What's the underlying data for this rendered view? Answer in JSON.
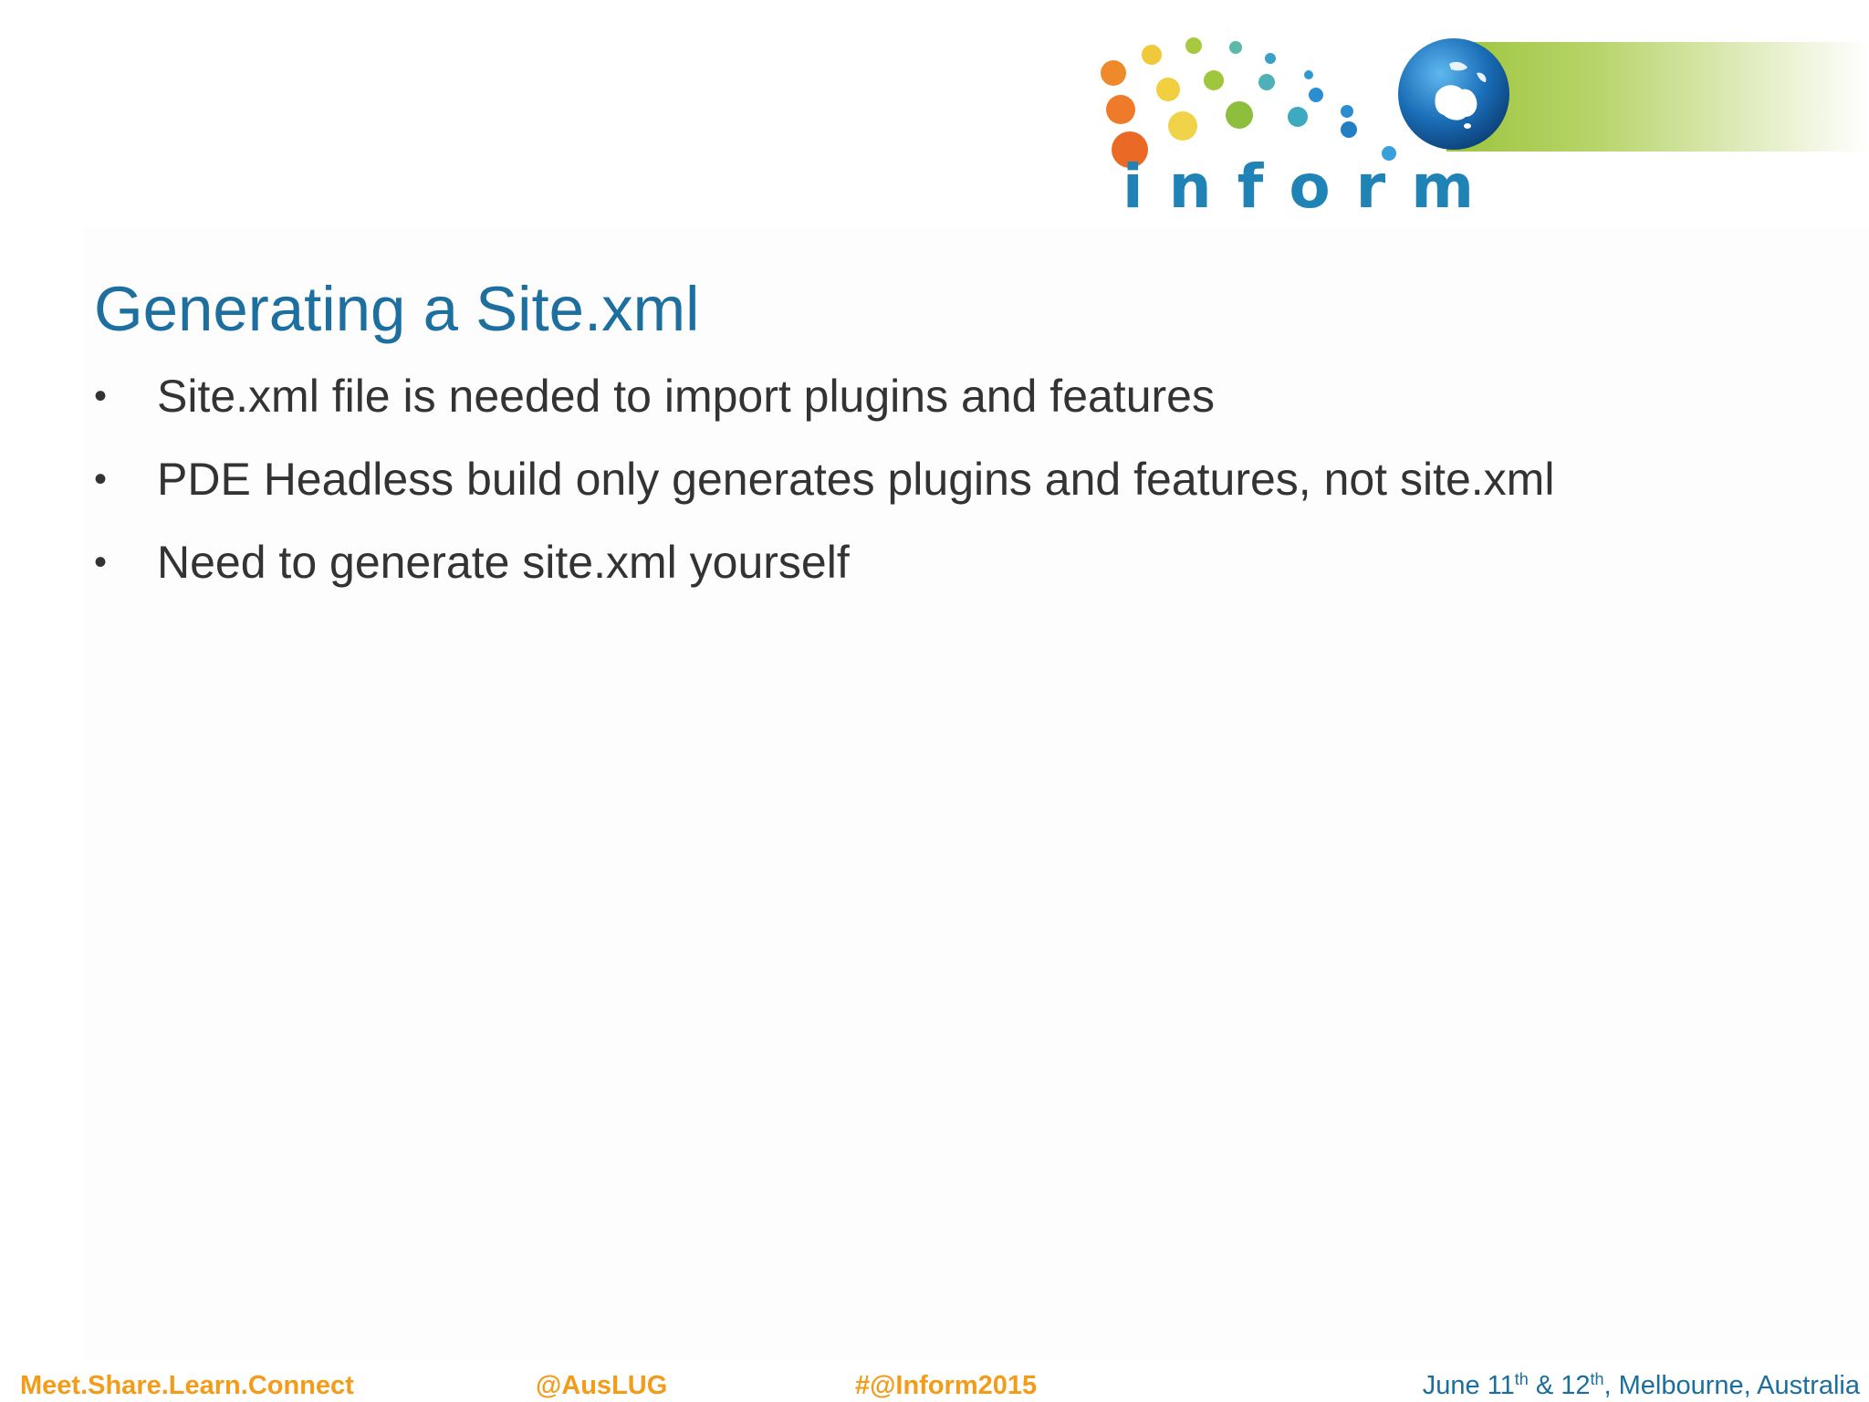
{
  "logo": {
    "wordmark": "inform"
  },
  "slide": {
    "title": "Generating a Site.xml",
    "bullets": [
      "Site.xml file is needed to import plugins and features",
      "PDE Headless build only generates plugins and features, not site.xml",
      "Need to generate site.xml yourself"
    ],
    "bullet_symbol": "•"
  },
  "footer": {
    "tagline": "Meet.Share.Learn.Connect",
    "twitter": "@AusLUG",
    "hashtag": "#@Inform2015",
    "date_prefix": "June 11",
    "date_sup1": "th",
    "date_mid": " & 12",
    "date_sup2": "th",
    "date_suffix": ", Melbourne, Australia"
  },
  "colors": {
    "title": "#1c6f9e",
    "body_text": "#333333",
    "footer_accent": "#f29c1a",
    "footer_date": "#1b6e9d",
    "logo_green": "#9cc43c",
    "logo_blue": "#1f83b5"
  }
}
